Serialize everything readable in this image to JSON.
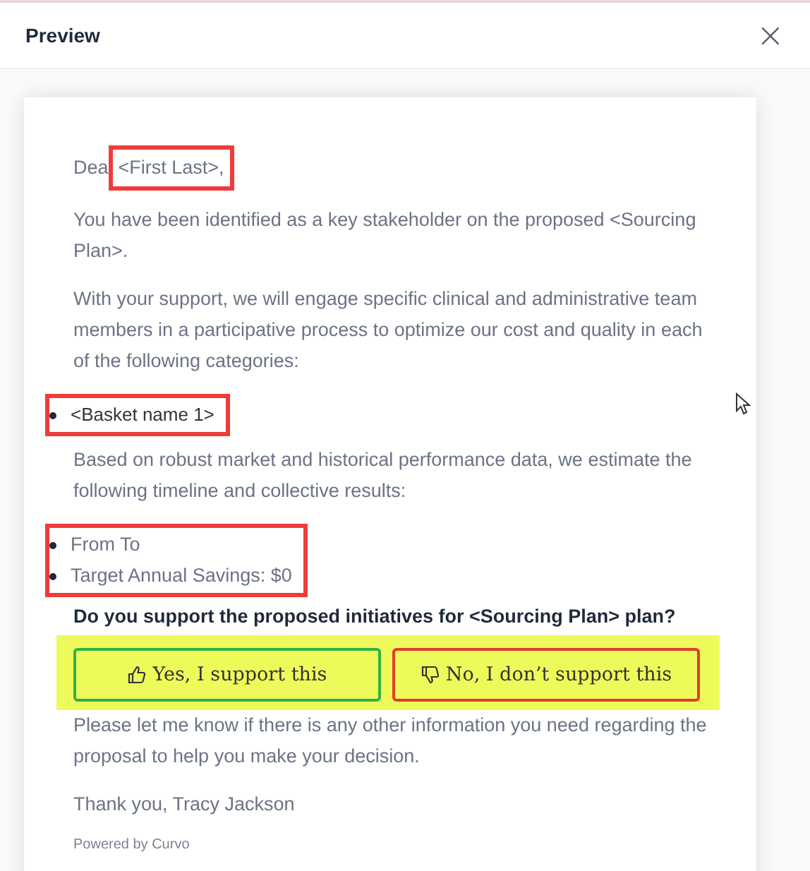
{
  "dialog": {
    "title": "Preview",
    "close": "×"
  },
  "blocks": [
    {
      "kind": "greeting",
      "text": "Dea",
      "name": "<First Last>,",
      "highlighted": true
    },
    {
      "kind": "paragraph",
      "text": "You have been identified as a key stakeholder on the proposed <Sourcing Plan>."
    },
    {
      "kind": "paragraph",
      "text": "With your support, we will engage specific clinical and administrative team members in a participative process to optimize our cost and quality in each of the following categories:"
    },
    {
      "kind": "list",
      "highlighted": true,
      "items": [
        "<Basket name 1>"
      ]
    },
    {
      "kind": "paragraph",
      "text": "Based on robust market and historical performance data, we estimate the following timeline and collective results:"
    },
    {
      "kind": "list",
      "highlighted": true,
      "items": [
        "From To",
        "Target Annual Savings: $0"
      ]
    },
    {
      "kind": "question",
      "text": "Do you support the proposed initiatives for <Sourcing Plan> plan?"
    },
    {
      "kind": "buttons",
      "highlighted": true,
      "buttons": [
        {
          "kind": "approve",
          "label": "Yes, I support this"
        },
        {
          "kind": "decline",
          "label": "No, I don’t support this"
        }
      ]
    },
    {
      "kind": "paragraph",
      "text": "Please let me know if there is any other information you need regarding the proposal to help you make your decision."
    },
    {
      "kind": "paragraph",
      "text": "Thank you, Tracy Jackson"
    },
    {
      "kind": "footer",
      "text": "Powered by Curvo"
    }
  ]
}
